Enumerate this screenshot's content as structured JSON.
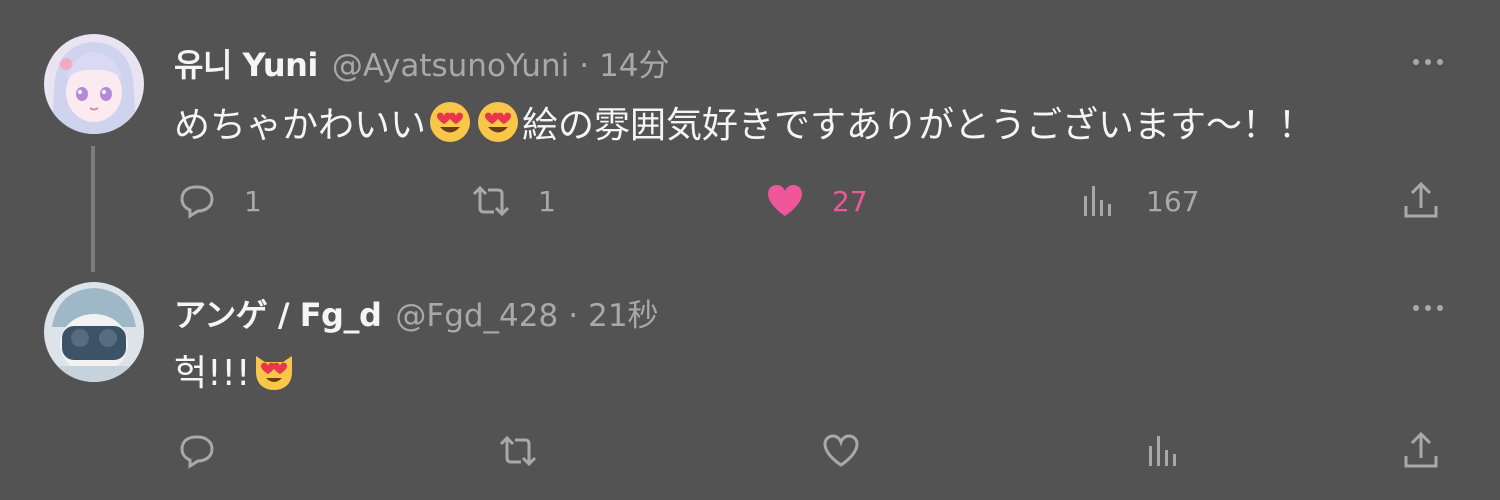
{
  "tweets": [
    {
      "name": "유니 Yuni",
      "handle": "@AyatsunoYuni",
      "separator": "·",
      "time": "14分",
      "text_before": "めちゃかわいい",
      "emojis": [
        "smiling-face-heart-eyes",
        "smiling-face-heart-eyes"
      ],
      "text_after": "絵の雰囲気好きですありがとうございます～！！",
      "replies": "1",
      "retweets": "1",
      "likes": "27",
      "views": "167",
      "liked": true
    },
    {
      "name": "アンゲ / Fg_d",
      "handle": "@Fgd_428",
      "separator": "·",
      "time": "21秒",
      "text_before": "헉!!!",
      "emojis": [
        "smiling-cat-heart-eyes"
      ],
      "text_after": "",
      "replies": "",
      "retweets": "",
      "likes": "",
      "views": "",
      "liked": false
    }
  ],
  "colors": {
    "background": "#535353",
    "muted": "#a9a9a9",
    "like_accent": "#f0579a"
  }
}
